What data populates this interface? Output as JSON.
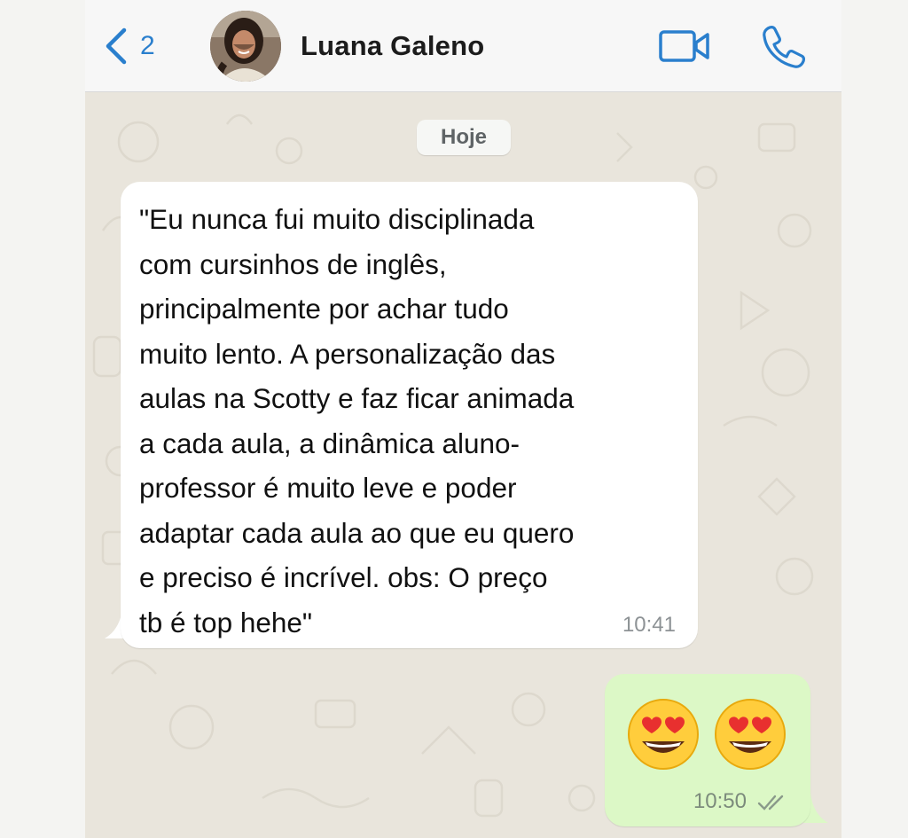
{
  "header": {
    "back_count": "2",
    "contact_name": "Luana Galeno",
    "icons": [
      "chevron-left-icon",
      "video-camera-icon",
      "phone-icon"
    ]
  },
  "chat": {
    "date_label": "Hoje",
    "messages": [
      {
        "direction": "incoming",
        "text": "\"Eu nunca fui muito disciplinada\ncom cursinhos de inglês,\nprincipalmente por achar tudo\nmuito lento. A personalização das\naulas na Scotty e faz ficar animada\na cada aula, a dinâmica aluno-\nprofessor é muito leve e poder\nadaptar cada aula ao que eu quero\ne preciso é incrível. obs: O preço\ntb é top hehe\"",
        "time": "10:41"
      },
      {
        "direction": "outgoing",
        "emoji": [
          "smiling-face-with-heart-eyes-emoji",
          "smiling-face-with-heart-eyes-emoji"
        ],
        "time": "10:50",
        "status": "read-double-check"
      }
    ]
  },
  "colors": {
    "accent": "#2a7fcd",
    "chat_background": "#e9e5dc",
    "incoming_bubble": "#ffffff",
    "outgoing_bubble": "#dcf8c6",
    "header_background": "#f7f7f7"
  }
}
